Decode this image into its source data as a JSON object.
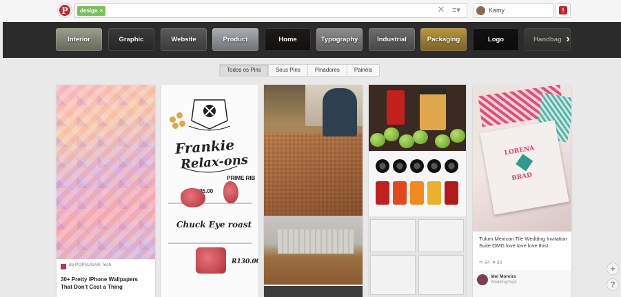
{
  "search": {
    "tag": "design",
    "tag_remove": "×",
    "clear": "✕",
    "menu": "≡▾"
  },
  "user": {
    "name": "Kamy"
  },
  "notifications": {
    "badge": "!"
  },
  "categories": [
    {
      "label": "Interior",
      "color": "#9b9f8a"
    },
    {
      "label": "Graphic",
      "color": "#3a3a3a"
    },
    {
      "label": "Website",
      "color": "#5a5a5a"
    },
    {
      "label": "Product",
      "color": "#a9aeb3"
    },
    {
      "label": "Home",
      "color": "#1d1a18"
    },
    {
      "label": "Typography",
      "color": "#8e8e8e"
    },
    {
      "label": "Industrial",
      "color": "#6d6d6d"
    },
    {
      "label": "Packaging",
      "color": "#b8973e"
    },
    {
      "label": "Logo",
      "color": "#111111"
    },
    {
      "label": "Handbag",
      "color": "#4a4a44"
    }
  ],
  "category_next": "›",
  "tabs": [
    "Todos os Pins",
    "Seus Pins",
    "Pinadores",
    "Painéis"
  ],
  "pins": {
    "pin1": {
      "source": "de POPSUGAR Tech",
      "title": "30+ Pretty iPhone Wallpapers That Don't Cost a Thing"
    },
    "pin2": {
      "t1": "Frankie",
      "t2": "Relax-ons",
      "t3": "Chuck Eye roast",
      "t4": "PRIME RIB",
      "t5": "R130.00",
      "t6": "R195.00"
    },
    "pin5": {
      "card_name1": "LORENA",
      "card_name2": "BRAD",
      "description": "Tulum Mexican Tile Wedding Invitation Suite OMG love love love this!",
      "repins": "84",
      "likes": "30",
      "pinner_name": "Idel Moreira",
      "pinner_board": "Wedding/Sept"
    }
  },
  "side_buttons": {
    "add": "+",
    "help": "?"
  },
  "colors": {
    "pinterest_red": "#cb2027",
    "tag_green": "#7bbf5a",
    "category_bar": "#2b2b2b"
  }
}
